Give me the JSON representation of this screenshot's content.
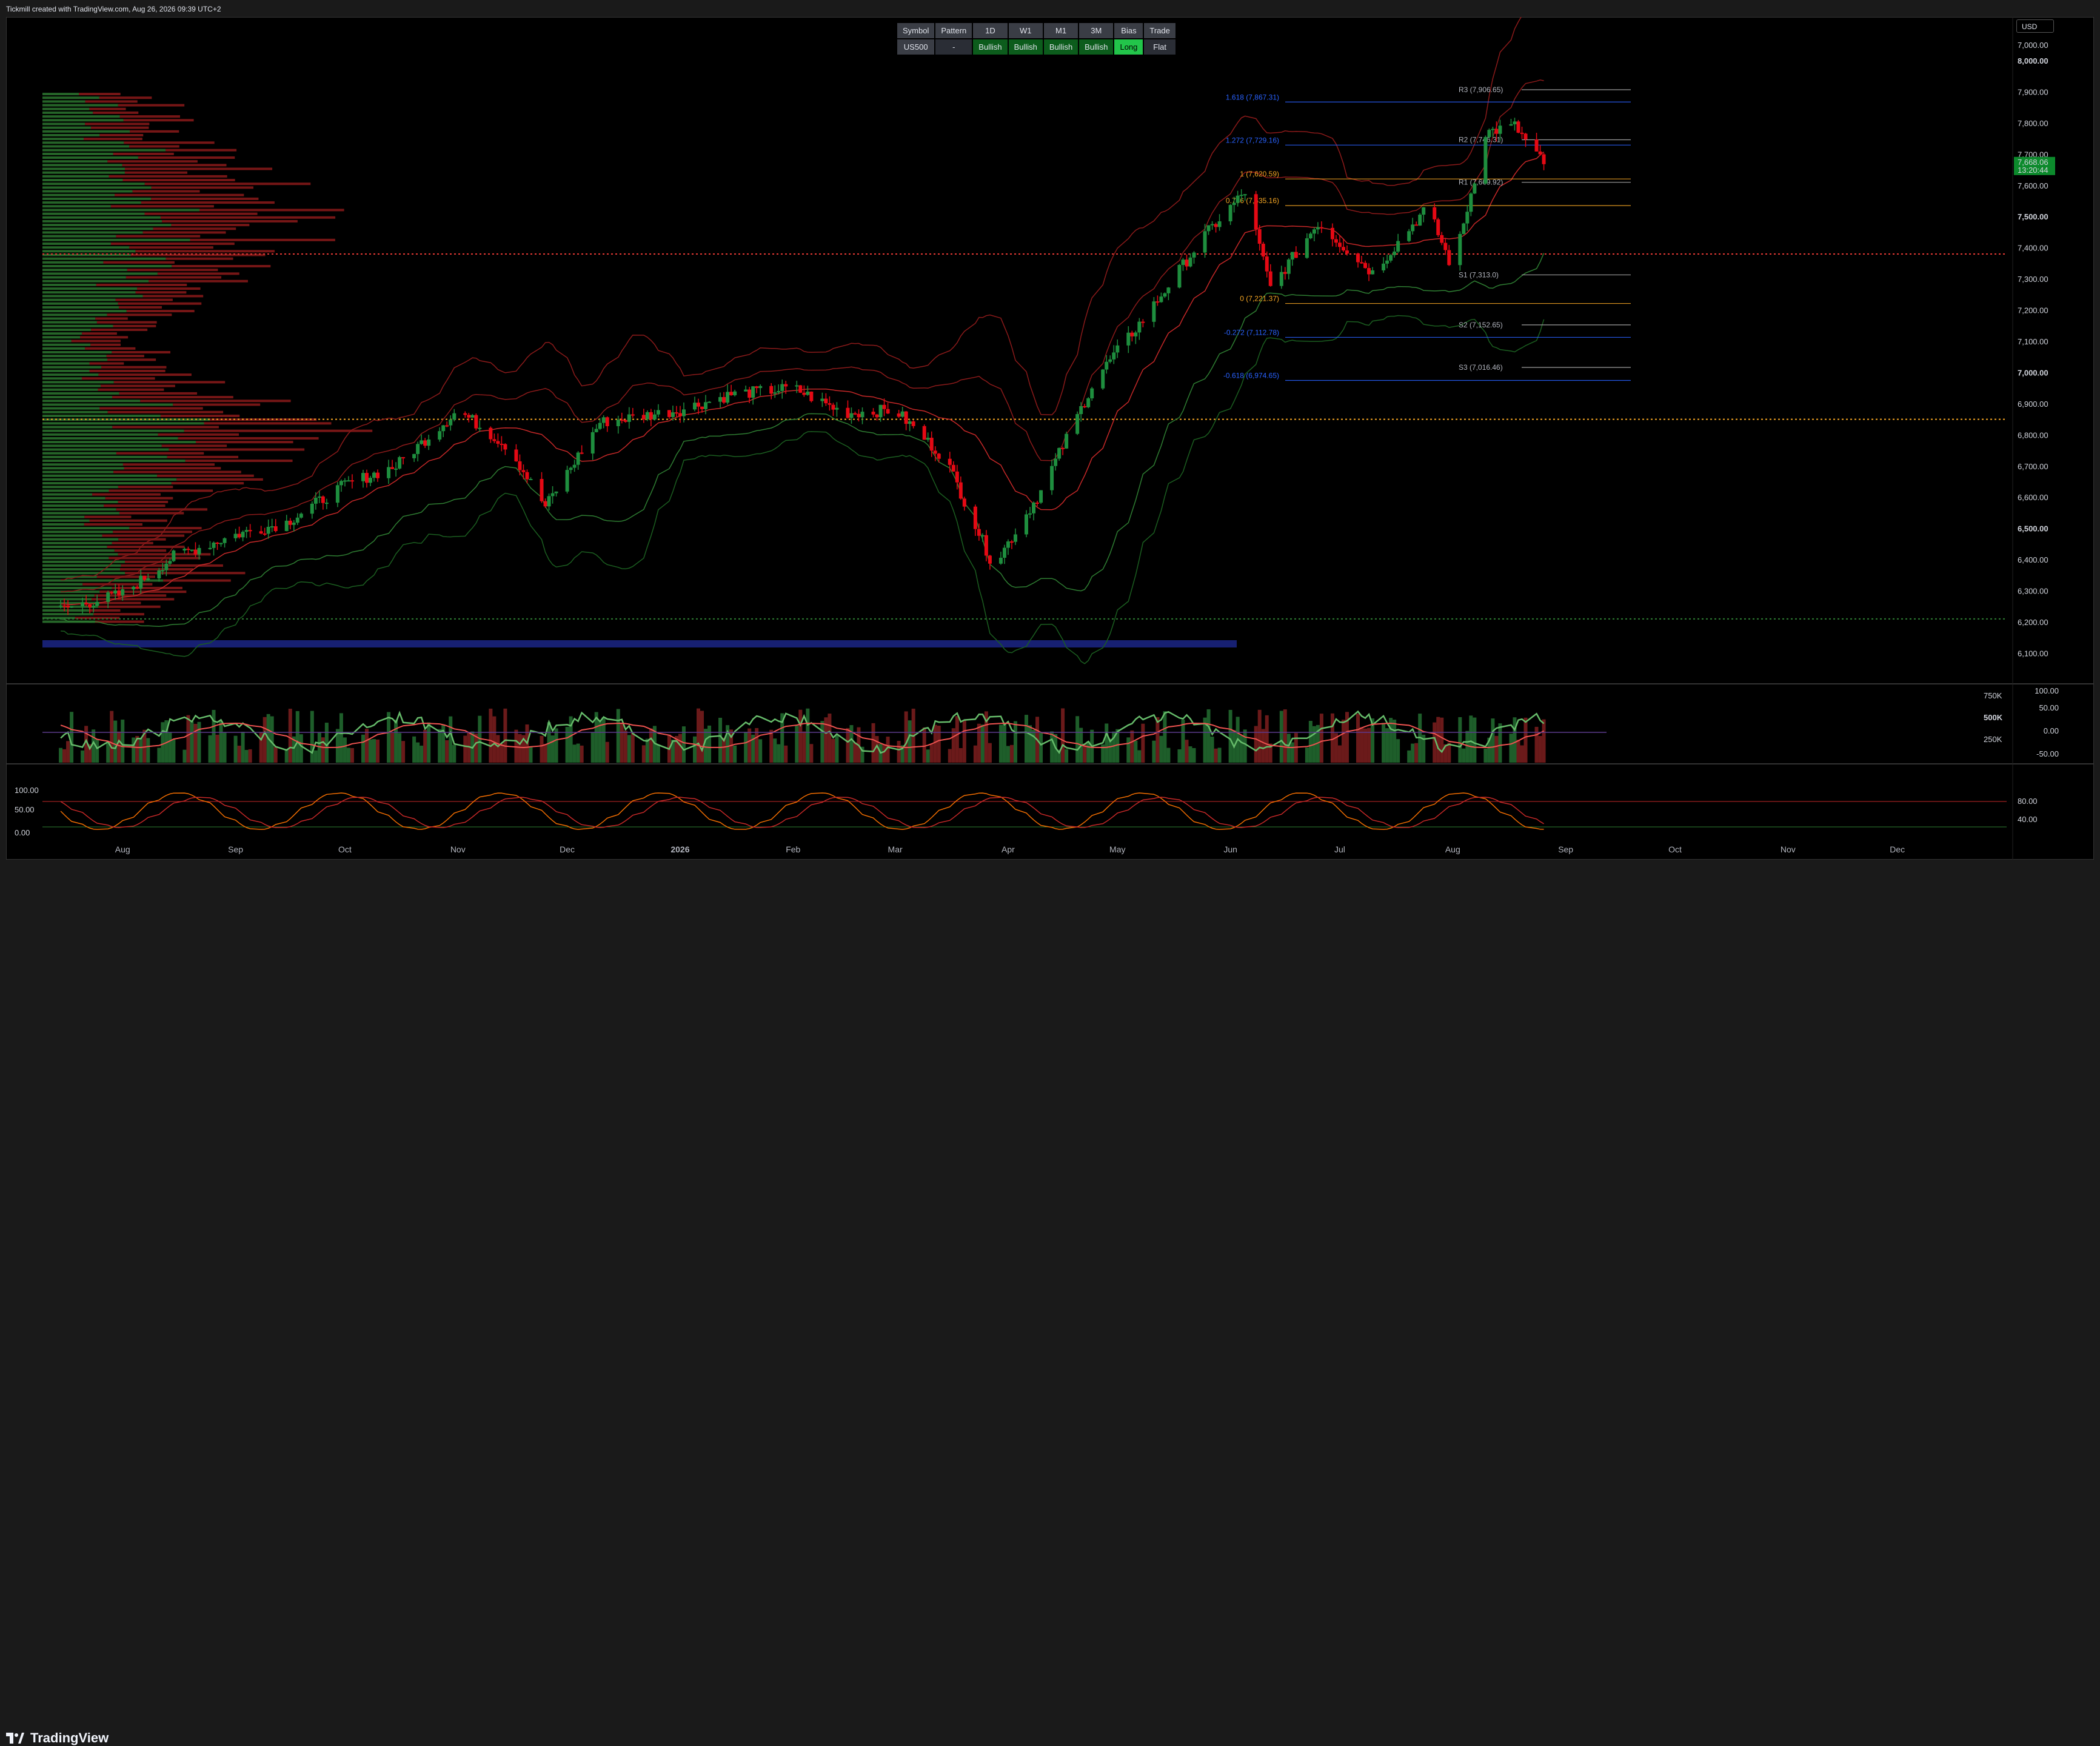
{
  "header": {
    "text": "Tickmill created with TradingView.com, Aug 26, 2026 09:39 UTC+2"
  },
  "signal_table": {
    "headers": [
      "Symbol",
      "Pattern",
      "1D",
      "W1",
      "M1",
      "3M",
      "Bias",
      "Trade"
    ],
    "row": [
      "US500",
      "-",
      "Bullish",
      "Bullish",
      "Bullish",
      "Bullish",
      "Long",
      "Flat"
    ]
  },
  "currency": "USD",
  "footer": {
    "brand": "TradingView"
  },
  "colors": {
    "up": "#1e8e3e",
    "down": "#e50914",
    "fib": "#2962ff",
    "fib_gold": "#f5a623",
    "accent_long": "#22c54a"
  },
  "chart_data": {
    "type": "line",
    "symbol": "US500",
    "y_axis_ticks": [
      "8,000.00",
      "7,900.00",
      "7,800.00",
      "7,700.00",
      "7,600.00",
      "7,500.00",
      "7,400.00",
      "7,300.00",
      "7,200.00",
      "7,100.00",
      "7,000.00",
      "6,900.00",
      "6,800.00",
      "6,700.00",
      "6,600.00",
      "6,500.00",
      "6,400.00",
      "6,300.00",
      "6,200.00",
      "6,100.00"
    ],
    "y_axis_top": "7,000.00",
    "ylim": [
      6060,
      8000
    ],
    "x_axis_ticks": [
      "Aug",
      "Sep",
      "Oct",
      "Nov",
      "Dec",
      "2026",
      "Feb",
      "Mar",
      "Apr",
      "May",
      "Jun",
      "Jul",
      "Aug",
      "Sep",
      "Oct",
      "Nov",
      "Dec"
    ],
    "last_price": "7,668.06",
    "countdown": "13:20:44",
    "price_path": [
      {
        "date": "2025-07-15",
        "close": 6240
      },
      {
        "date": "2025-08-01",
        "close": 6290
      },
      {
        "date": "2025-08-15",
        "close": 6410
      },
      {
        "date": "2025-09-01",
        "close": 6480
      },
      {
        "date": "2025-09-15",
        "close": 6520
      },
      {
        "date": "2025-10-01",
        "close": 6640
      },
      {
        "date": "2025-10-15",
        "close": 6700
      },
      {
        "date": "2025-11-01",
        "close": 6880
      },
      {
        "date": "2025-11-15",
        "close": 6760
      },
      {
        "date": "2025-11-25",
        "close": 6570
      },
      {
        "date": "2025-12-10",
        "close": 6840
      },
      {
        "date": "2026-01-01",
        "close": 6880
      },
      {
        "date": "2026-01-15",
        "close": 6930
      },
      {
        "date": "2026-02-01",
        "close": 6950
      },
      {
        "date": "2026-02-15",
        "close": 6870
      },
      {
        "date": "2026-03-01",
        "close": 6880
      },
      {
        "date": "2026-03-15",
        "close": 6720
      },
      {
        "date": "2026-03-28",
        "close": 6380
      },
      {
        "date": "2026-04-10",
        "close": 6620
      },
      {
        "date": "2026-04-25",
        "close": 6980
      },
      {
        "date": "2026-05-10",
        "close": 7200
      },
      {
        "date": "2026-05-25",
        "close": 7440
      },
      {
        "date": "2026-06-05",
        "close": 7580
      },
      {
        "date": "2026-06-12",
        "close": 7270
      },
      {
        "date": "2026-06-25",
        "close": 7480
      },
      {
        "date": "2026-07-10",
        "close": 7320
      },
      {
        "date": "2026-07-25",
        "close": 7530
      },
      {
        "date": "2026-08-01",
        "close": 7330
      },
      {
        "date": "2026-08-10",
        "close": 7770
      },
      {
        "date": "2026-08-18",
        "close": 7790
      },
      {
        "date": "2026-08-26",
        "close": 7668
      }
    ],
    "fib_levels": [
      {
        "label": "1.618 (7,867.31)",
        "value": 7867.31,
        "color": "#2962ff"
      },
      {
        "label": "1.272 (7,729.16)",
        "value": 7729.16,
        "color": "#2962ff"
      },
      {
        "label": "1 (7,620.59)",
        "value": 7620.59,
        "color": "#f5a623"
      },
      {
        "label": "0.786 (7,535.16)",
        "value": 7535.16,
        "color": "#f5a623"
      },
      {
        "label": "0 (7,221.37)",
        "value": 7221.37,
        "color": "#f5a623"
      },
      {
        "label": "-0.272 (7,112.78)",
        "value": 7112.78,
        "color": "#2962ff"
      },
      {
        "label": "-0.618 (6,974.65)",
        "value": 6974.65,
        "color": "#2962ff"
      }
    ],
    "pivots": [
      {
        "label": "R3 (7,906.65)",
        "value": 7906.65
      },
      {
        "label": "R2 (7,746.31)",
        "value": 7746.31
      },
      {
        "label": "R1 (7,609.92)",
        "value": 7609.92
      },
      {
        "label": "S1 (7,313.0)",
        "value": 7313.0
      },
      {
        "label": "S2 (7,152.65)",
        "value": 7152.65
      },
      {
        "label": "S3 (7,016.46)",
        "value": 7016.46
      }
    ],
    "hlines": [
      {
        "value": 7380,
        "style": "dotted",
        "color": "#e53935"
      },
      {
        "value": 6850,
        "style": "dotted",
        "color": "#f5a623"
      },
      {
        "value": 6210,
        "style": "dotted",
        "color": "#2e7d32"
      }
    ],
    "volume_panel": {
      "right_ticks": [
        "750K",
        "500K",
        "250K"
      ],
      "left_ticks": [
        "100.00",
        "50.00",
        "0.00",
        "-50.00"
      ]
    },
    "oscillator_panel": {
      "left_ticks": [
        "100.00",
        "50.00",
        "0.00"
      ],
      "right_ticks": [
        "80.00",
        "40.00"
      ]
    }
  }
}
